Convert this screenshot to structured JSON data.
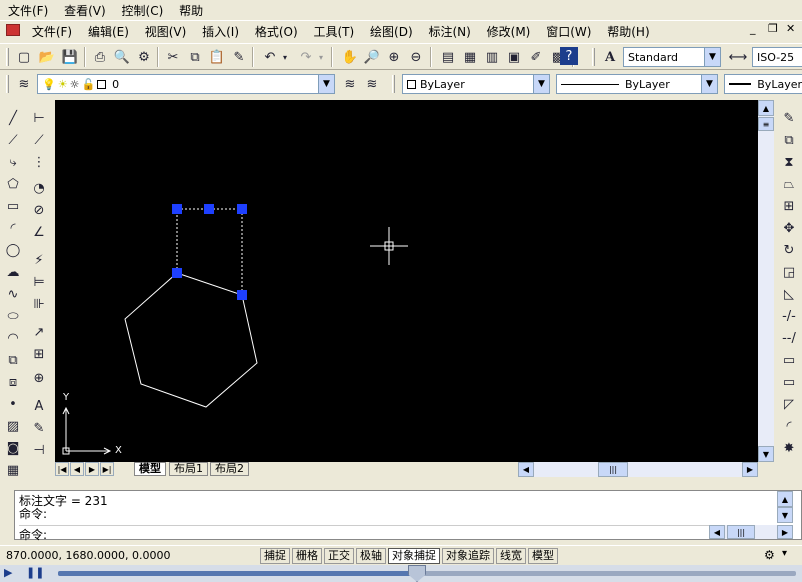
{
  "menubar_top": {
    "items": [
      "文件(F)",
      "查看(V)",
      "控制(C)",
      "帮助"
    ]
  },
  "menubar_app": {
    "items": [
      "文件(F)",
      "编辑(E)",
      "视图(V)",
      "插入(I)",
      "格式(O)",
      "工具(T)",
      "绘图(D)",
      "标注(N)",
      "修改(M)",
      "窗口(W)",
      "帮助(H)"
    ]
  },
  "window_controls": {
    "minimize": "_",
    "restore": "❐",
    "close": "✕"
  },
  "toolbar": {
    "text_style": "Standard",
    "dim_style": "ISO-25",
    "layer": "0",
    "color": "ByLayer",
    "linetype": "ByLayer",
    "lineweight": "ByLayer"
  },
  "canvas": {
    "ucs_x": "X",
    "ucs_y": "Y",
    "colors": {
      "background": "#000000",
      "geometry": "#ffffff",
      "grip": "#1e40ff"
    }
  },
  "layout_tabs": {
    "model": "模型",
    "layout1": "布局1",
    "layout2": "布局2"
  },
  "command": {
    "history_line": "标注文字 = 231",
    "prompt1": "命令:",
    "prompt2": "命令:"
  },
  "status": {
    "coords": "870.0000,  1680.0000,  0.0000",
    "toggles": [
      "捕捉",
      "栅格",
      "正交",
      "极轴",
      "对象捕捉",
      "对象追踪",
      "线宽",
      "模型"
    ]
  }
}
